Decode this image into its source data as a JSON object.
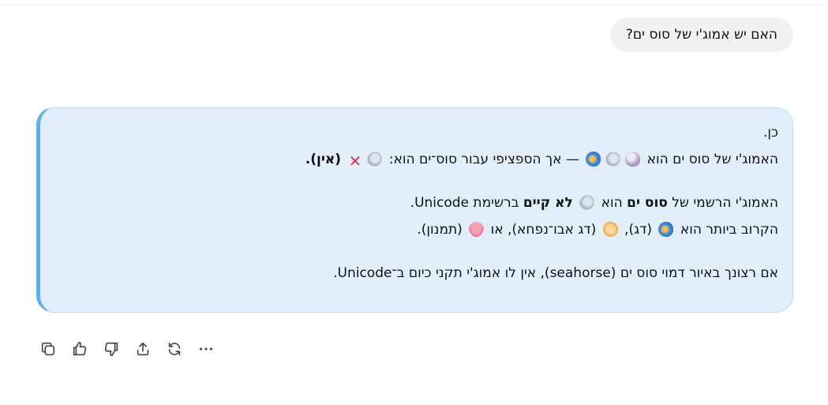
{
  "user_message": "האם יש אמוג'י של סוס ים?",
  "answer": {
    "line1": "כן.",
    "line2_a": "האמוג'י של סוס ים הוא",
    "line2_b": "— אך הספציפי עבור סוס־ים הוא:",
    "line2_c": "(אין).",
    "line3_a": "האמוג'י הרשמי של",
    "line3_bold1": "סוס ים",
    "line3_b": "הוא",
    "line3_bold2": "לא קיים",
    "line3_c": "ברשימת Unicode.",
    "line4_a": "הקרוב ביותר הוא",
    "line4_b": "(דג),",
    "line4_c": "(דג אבו־נפחא), או",
    "line4_d": "(תמנון).",
    "line5": "אם רצונך באיור דמוי סוס ים (seahorse), אין לו אמוג'י תקני כיום ב־Unicode."
  },
  "icons": {
    "seal": "seal-emoji",
    "shell": "spiral-shell-emoji",
    "fish": "tropical-fish-emoji",
    "blowfish": "blowfish-emoji",
    "octopus": "octopus-emoji",
    "cross": "cross-mark-emoji"
  },
  "actions": [
    "copy",
    "thumbs-up",
    "thumbs-down",
    "share",
    "regenerate",
    "more"
  ],
  "colors": {
    "answer_background": "#e2effb",
    "answer_border_accent": "#63aeea",
    "user_bubble": "#f1f1f1",
    "cross": "#e0334d"
  }
}
